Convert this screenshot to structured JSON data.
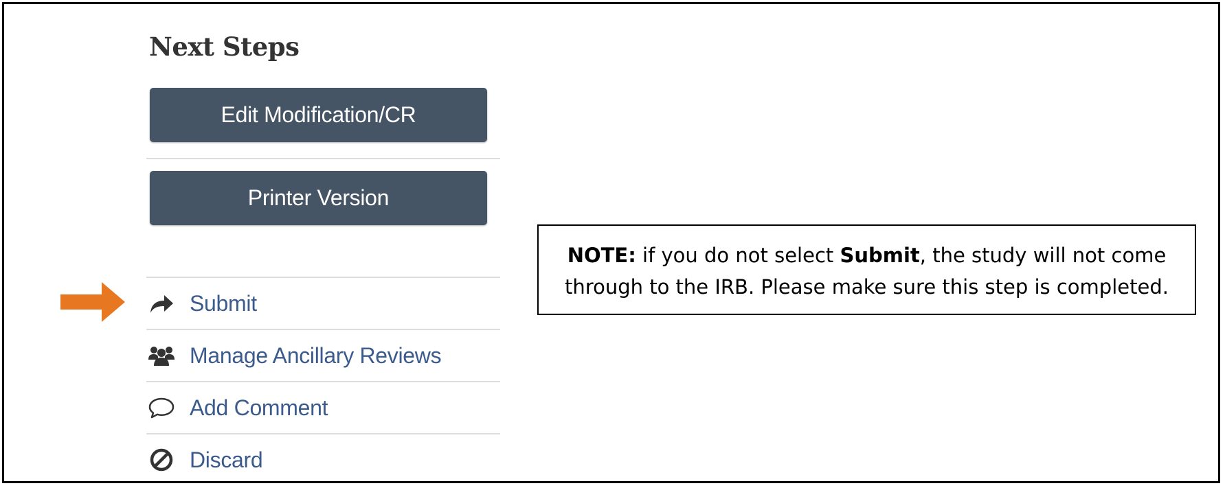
{
  "next_steps": {
    "heading": "Next Steps",
    "buttons": [
      {
        "label": "Edit Modification/CR"
      },
      {
        "label": "Printer Version"
      }
    ],
    "actions": [
      {
        "label": "Submit",
        "icon": "share-arrow-icon"
      },
      {
        "label": "Manage Ancillary Reviews",
        "icon": "users-group-icon"
      },
      {
        "label": "Add Comment",
        "icon": "speech-bubble-icon"
      },
      {
        "label": "Discard",
        "icon": "ban-circle-icon"
      }
    ]
  },
  "callout": {
    "arrow_color": "#E87722",
    "note": {
      "prefix_bold": "NOTE:",
      "text_1": " if you do not select ",
      "bold_word": "Submit",
      "text_2": ", the study will not come",
      "line_2": "through to the IRB. Please make sure this step is completed."
    }
  },
  "colors": {
    "button_bg": "#455565",
    "button_text": "#FFFFFF",
    "link_text": "#3B5B8C",
    "icon": "#333333",
    "divider": "#DDDDDD",
    "heading": "#333333"
  }
}
